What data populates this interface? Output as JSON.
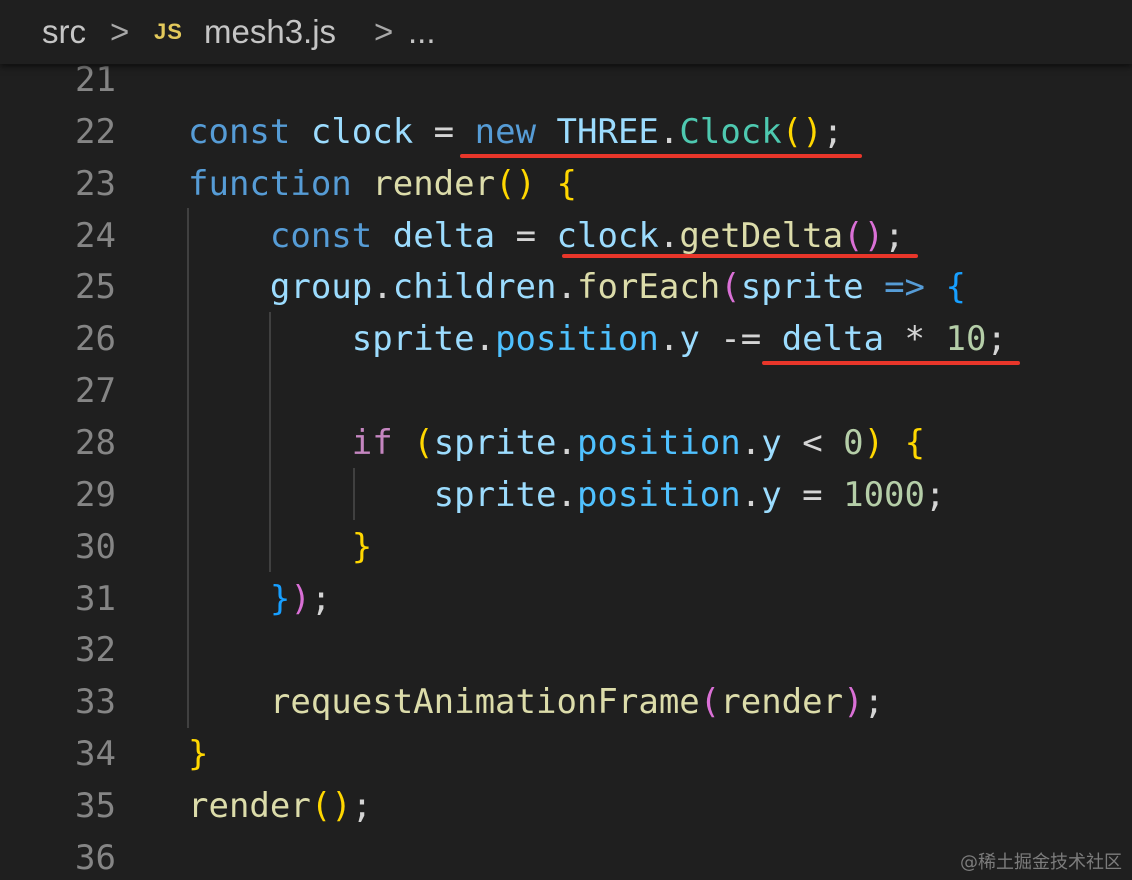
{
  "breadcrumb": {
    "folder": "src",
    "separator": ">",
    "file_icon": "JS",
    "file_name": "mesh3.js",
    "ellipsis": "..."
  },
  "editor": {
    "language": "javascript",
    "lines": [
      {
        "number": "21",
        "tokens": []
      },
      {
        "number": "22",
        "tokens": [
          {
            "t": "const",
            "c": "kw"
          },
          {
            "t": " "
          },
          {
            "t": "clock",
            "c": "var"
          },
          {
            "t": " = ",
            "c": "op"
          },
          {
            "t": "new",
            "c": "kw"
          },
          {
            "t": " "
          },
          {
            "t": "THREE",
            "c": "var"
          },
          {
            "t": ".",
            "c": "op"
          },
          {
            "t": "Clock",
            "c": "cls"
          },
          {
            "t": "()",
            "c": "p1"
          },
          {
            "t": ";",
            "c": "op"
          }
        ]
      },
      {
        "number": "23",
        "tokens": [
          {
            "t": "function",
            "c": "kw"
          },
          {
            "t": " "
          },
          {
            "t": "render",
            "c": "fn"
          },
          {
            "t": "()",
            "c": "p1"
          },
          {
            "t": " "
          },
          {
            "t": "{",
            "c": "p1"
          }
        ]
      },
      {
        "number": "24",
        "tokens": [
          {
            "t": "    "
          },
          {
            "t": "const",
            "c": "kw"
          },
          {
            "t": " "
          },
          {
            "t": "delta",
            "c": "var"
          },
          {
            "t": " = ",
            "c": "op"
          },
          {
            "t": "clock",
            "c": "var"
          },
          {
            "t": ".",
            "c": "op"
          },
          {
            "t": "getDelta",
            "c": "fn"
          },
          {
            "t": "()",
            "c": "p2"
          },
          {
            "t": ";",
            "c": "op"
          }
        ]
      },
      {
        "number": "25",
        "tokens": [
          {
            "t": "    "
          },
          {
            "t": "group",
            "c": "var"
          },
          {
            "t": ".",
            "c": "op"
          },
          {
            "t": "children",
            "c": "var"
          },
          {
            "t": ".",
            "c": "op"
          },
          {
            "t": "forEach",
            "c": "fn"
          },
          {
            "t": "(",
            "c": "p2"
          },
          {
            "t": "sprite",
            "c": "var"
          },
          {
            "t": " "
          },
          {
            "t": "=>",
            "c": "kw"
          },
          {
            "t": " "
          },
          {
            "t": "{",
            "c": "p3"
          }
        ]
      },
      {
        "number": "26",
        "tokens": [
          {
            "t": "        "
          },
          {
            "t": "sprite",
            "c": "var"
          },
          {
            "t": ".",
            "c": "op"
          },
          {
            "t": "position",
            "c": "prop"
          },
          {
            "t": ".",
            "c": "op"
          },
          {
            "t": "y",
            "c": "var"
          },
          {
            "t": " -= ",
            "c": "op"
          },
          {
            "t": "delta",
            "c": "var"
          },
          {
            "t": " * ",
            "c": "op"
          },
          {
            "t": "10",
            "c": "num"
          },
          {
            "t": ";",
            "c": "op"
          }
        ]
      },
      {
        "number": "27",
        "tokens": []
      },
      {
        "number": "28",
        "tokens": [
          {
            "t": "        "
          },
          {
            "t": "if",
            "c": "ctl"
          },
          {
            "t": " "
          },
          {
            "t": "(",
            "c": "p1"
          },
          {
            "t": "sprite",
            "c": "var"
          },
          {
            "t": ".",
            "c": "op"
          },
          {
            "t": "position",
            "c": "prop"
          },
          {
            "t": ".",
            "c": "op"
          },
          {
            "t": "y",
            "c": "var"
          },
          {
            "t": " < ",
            "c": "op"
          },
          {
            "t": "0",
            "c": "num"
          },
          {
            "t": ")",
            "c": "p1"
          },
          {
            "t": " "
          },
          {
            "t": "{",
            "c": "p1"
          }
        ]
      },
      {
        "number": "29",
        "tokens": [
          {
            "t": "            "
          },
          {
            "t": "sprite",
            "c": "var"
          },
          {
            "t": ".",
            "c": "op"
          },
          {
            "t": "position",
            "c": "prop"
          },
          {
            "t": ".",
            "c": "op"
          },
          {
            "t": "y",
            "c": "var"
          },
          {
            "t": " = ",
            "c": "op"
          },
          {
            "t": "1000",
            "c": "num"
          },
          {
            "t": ";",
            "c": "op"
          }
        ]
      },
      {
        "number": "30",
        "tokens": [
          {
            "t": "        "
          },
          {
            "t": "}",
            "c": "p1"
          }
        ]
      },
      {
        "number": "31",
        "tokens": [
          {
            "t": "    "
          },
          {
            "t": "}",
            "c": "p3"
          },
          {
            "t": ")",
            "c": "p2"
          },
          {
            "t": ";",
            "c": "op"
          }
        ]
      },
      {
        "number": "32",
        "tokens": []
      },
      {
        "number": "33",
        "tokens": [
          {
            "t": "    "
          },
          {
            "t": "requestAnimationFrame",
            "c": "fn"
          },
          {
            "t": "(",
            "c": "p2"
          },
          {
            "t": "render",
            "c": "fn"
          },
          {
            "t": ")",
            "c": "p2"
          },
          {
            "t": ";",
            "c": "op"
          }
        ]
      },
      {
        "number": "34",
        "tokens": [
          {
            "t": "}",
            "c": "p1"
          }
        ]
      },
      {
        "number": "35",
        "tokens": [
          {
            "t": "render",
            "c": "fn"
          },
          {
            "t": "()",
            "c": "p1"
          },
          {
            "t": ";",
            "c": "op"
          }
        ]
      },
      {
        "number": "36",
        "tokens": []
      }
    ]
  },
  "annotations": {
    "underline_color": "#e8362a"
  },
  "watermark": "@稀土掘金技术社区",
  "colors": {
    "background": "#1f1f1f",
    "line_number": "#858585",
    "keyword": "#569cd6",
    "control": "#c586c0",
    "variable": "#9cdcfe",
    "property": "#4fc1ff",
    "function": "#dcdcaa",
    "class": "#4ec9b0",
    "number": "#b5cea8",
    "bracket_gold": "#ffd700",
    "bracket_orchid": "#da70d6",
    "bracket_blue": "#179fff"
  }
}
